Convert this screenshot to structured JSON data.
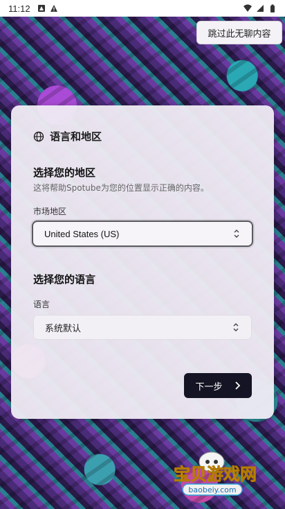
{
  "status_bar": {
    "time": "11:12"
  },
  "skip_button": {
    "label": "跳过此无聊内容"
  },
  "card": {
    "title": "语言和地区",
    "region": {
      "heading": "选择您的地区",
      "description": "这将帮助Spotube为您的位置显示正确的内容。",
      "field_label": "市场地区",
      "selected_value": "United States (US)"
    },
    "language": {
      "heading": "选择您的语言",
      "field_label": "语言",
      "selected_value": "系统默认"
    },
    "next_button": {
      "label": "下一步"
    }
  },
  "watermark": {
    "title": "宝贝游戏网",
    "url": "baobeiy.com"
  },
  "colors": {
    "card_bg": "#f0ecf4",
    "primary_button": "#141424",
    "accent_purple": "#6a3aa0",
    "accent_teal": "#2a7f8f"
  },
  "icons": [
    "globe-icon",
    "chevron-updown-icon",
    "chevron-right-icon",
    "wifi-icon",
    "battery-icon"
  ]
}
